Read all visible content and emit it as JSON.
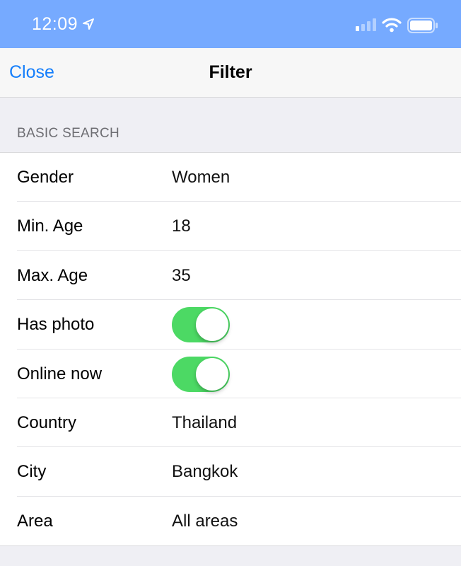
{
  "status_bar": {
    "time": "12:09",
    "location_icon": "location-arrow-icon",
    "signal_icon": "cellular-signal-icon",
    "wifi_icon": "wifi-icon",
    "battery_icon": "battery-icon"
  },
  "nav": {
    "close_label": "Close",
    "title": "Filter"
  },
  "section": {
    "header": "BASIC SEARCH",
    "rows": [
      {
        "label": "Gender",
        "value": "Women"
      },
      {
        "label": "Min. Age",
        "value": "18"
      },
      {
        "label": "Max. Age",
        "value": "35"
      },
      {
        "label": "Has photo",
        "toggle": true
      },
      {
        "label": "Online now",
        "toggle": true
      },
      {
        "label": "Country",
        "value": "Thailand"
      },
      {
        "label": "City",
        "value": "Bangkok"
      },
      {
        "label": "Area",
        "value": "All areas"
      }
    ]
  },
  "colors": {
    "status_bar": "#76aaff",
    "accent": "#147efb",
    "toggle_on": "#4cd964"
  }
}
